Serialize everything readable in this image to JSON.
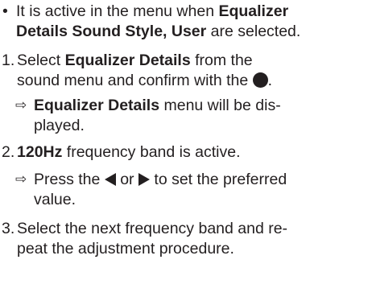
{
  "bullet": {
    "marker": "•",
    "line1_pre": "It is active in the menu when ",
    "line1_bold": "Equalizer",
    "line2_bold": "Details Sound Style, User",
    "line2_post": " are selected."
  },
  "step1": {
    "number": "1.",
    "line1_pre": "Select ",
    "line1_bold": "Equalizer Details",
    "line1_post": " from the",
    "line2_pre": "sound menu and confirm with the ",
    "line2_post": ".",
    "icon": "filled-circle-button-icon"
  },
  "result1": {
    "marker": "⇨",
    "line1_bold": "Equalizer Details",
    "line1_post": " menu will be dis-",
    "line2": "played."
  },
  "step2": {
    "number": "2.",
    "bold": "120Hz",
    "post": " frequency band is active."
  },
  "result2": {
    "marker": "⇨",
    "line1_pre": "Press the ",
    "line1_mid": " or ",
    "line1_post": " to set the preferred",
    "line2": "value.",
    "icons": [
      "left-triangle-icon",
      "right-triangle-icon"
    ]
  },
  "step3": {
    "number": "3.",
    "line1": "Select the next frequency band and re-",
    "line2": "peat the adjustment procedure."
  }
}
